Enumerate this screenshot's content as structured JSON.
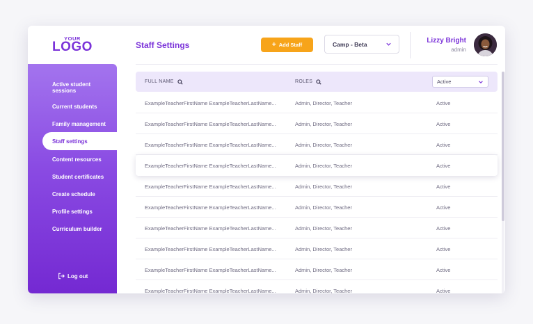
{
  "logo": {
    "small": "YOUR",
    "big": "LOGO"
  },
  "sidebar": {
    "items": [
      {
        "label": "Active student sessions"
      },
      {
        "label": "Current students"
      },
      {
        "label": "Family management"
      },
      {
        "label": "Staff settings"
      },
      {
        "label": "Content resources"
      },
      {
        "label": "Student certificates"
      },
      {
        "label": "Create schedule"
      },
      {
        "label": "Profile settings"
      },
      {
        "label": "Curriculum builder"
      }
    ],
    "active_index": 3,
    "logout_label": "Log out"
  },
  "header": {
    "title": "Staff Settings",
    "add_button": "Add Staff",
    "camp_select": "Camp - Beta",
    "user": {
      "name": "Lizzy Bright",
      "role": "admin"
    }
  },
  "table": {
    "columns": {
      "name": "FULL NAME",
      "roles": "ROLES"
    },
    "status_filter": "Active",
    "rows": [
      {
        "name": "ExampleTeacherFirstName ExampleTeacherLastName...",
        "roles": "Admin, Director, Teacher",
        "status": "Active"
      },
      {
        "name": "ExampleTeacherFirstName ExampleTeacherLastName...",
        "roles": "Admin, Director, Teacher",
        "status": "Active"
      },
      {
        "name": "ExampleTeacherFirstName ExampleTeacherLastName...",
        "roles": "Admin, Director, Teacher",
        "status": "Active"
      },
      {
        "name": "ExampleTeacherFirstName ExampleTeacherLastName...",
        "roles": "Admin, Director, Teacher",
        "status": "Active"
      },
      {
        "name": "ExampleTeacherFirstName ExampleTeacherLastName...",
        "roles": "Admin, Director, Teacher",
        "status": "Active"
      },
      {
        "name": "ExampleTeacherFirstName ExampleTeacherLastName...",
        "roles": "Admin, Director, Teacher",
        "status": "Active"
      },
      {
        "name": "ExampleTeacherFirstName ExampleTeacherLastName...",
        "roles": "Admin, Director, Teacher",
        "status": "Active"
      },
      {
        "name": "ExampleTeacherFirstName ExampleTeacherLastName...",
        "roles": "Admin, Director, Teacher",
        "status": "Active"
      },
      {
        "name": "ExampleTeacherFirstName ExampleTeacherLastName...",
        "roles": "Admin, Director, Teacher",
        "status": "Active"
      },
      {
        "name": "ExampleTeacherFirstName ExampleTeacherLastName...",
        "roles": "Admin, Director, Teacher",
        "status": "Active"
      }
    ],
    "highlighted_row": 3
  },
  "colors": {
    "brand": "#7b33d9",
    "accent": "#f7a41a",
    "header_bg": "#ede7fb"
  },
  "icons": [
    "search-icon",
    "chevron-down-icon",
    "plus-icon",
    "logout-icon",
    "avatar"
  ]
}
